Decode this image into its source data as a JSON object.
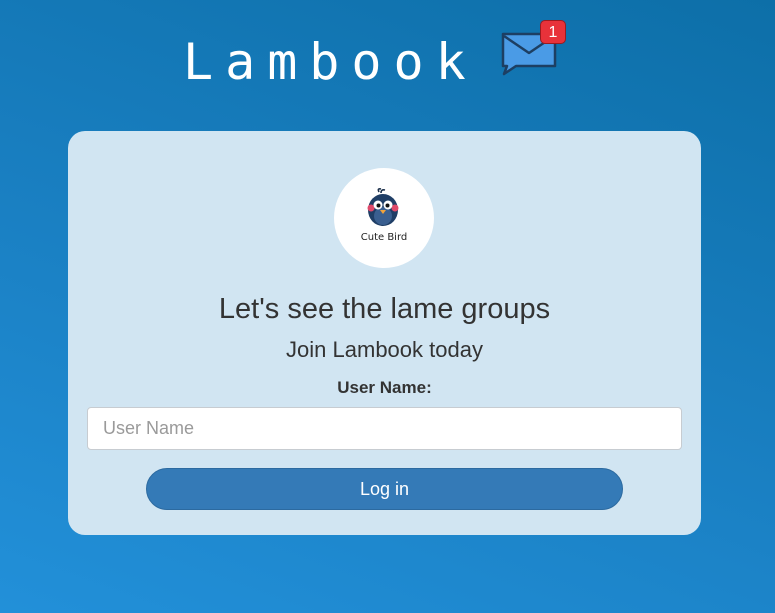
{
  "brand": {
    "title": "Lambook",
    "mail_icon": "envelope-icon",
    "notification_count": "1",
    "notification_color": "#e8323a"
  },
  "card": {
    "avatar": {
      "icon": "cute-bird-logo",
      "text": "Cute Bird"
    },
    "headline": "Let's see the lame groups",
    "subheadline": "Join Lambook today",
    "username_label": "User Name:",
    "username_placeholder": "User Name",
    "username_value": "",
    "login_label": "Log in"
  },
  "colors": {
    "background_top": "#0d6fa8",
    "background_bottom": "#2290d9",
    "card": "#d1e5f2",
    "button": "#347ab7"
  }
}
